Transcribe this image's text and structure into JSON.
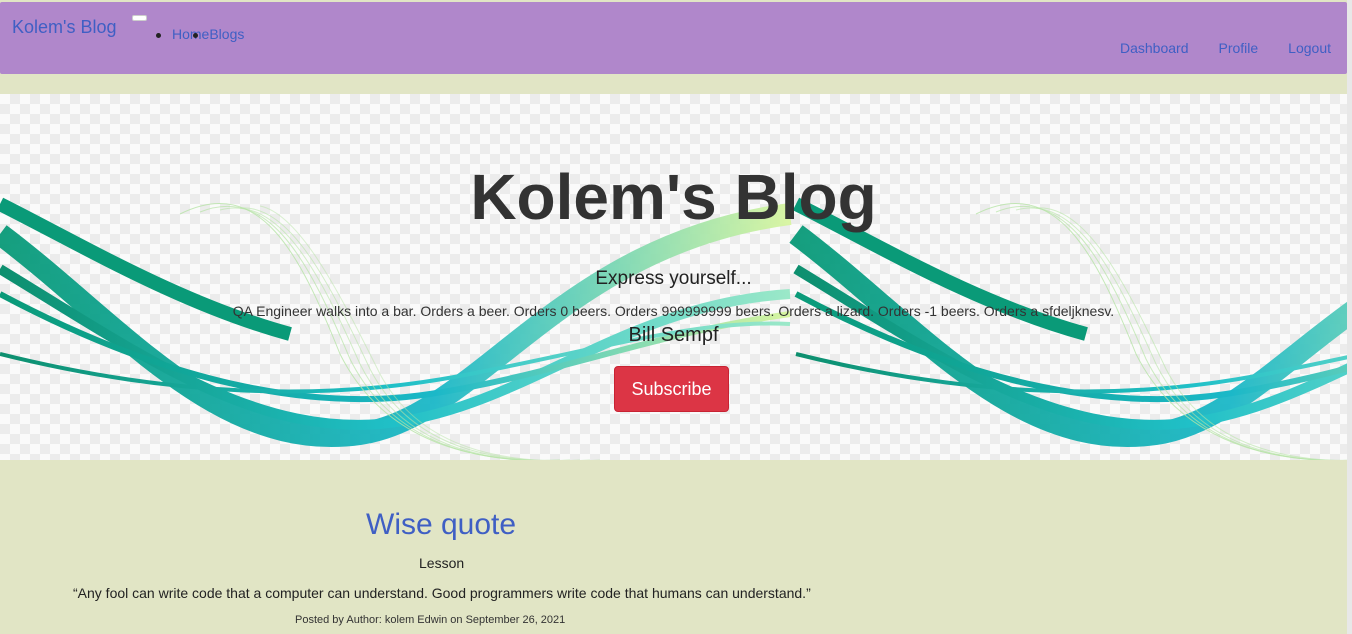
{
  "nav": {
    "brand": "Kolem's Blog",
    "left_links": "HomeBlogs",
    "right_links": [
      "Dashboard",
      "Profile",
      "Logout"
    ]
  },
  "hero": {
    "title": "Kolem's Blog",
    "subtitle": "Express yourself...",
    "quote": "QA Engineer walks into a bar. Orders a beer. Orders 0 beers. Orders 999999999 beers. Orders a lizard. Orders -1 beers. Orders a sfdeljknesv.",
    "author": "Bill Sempf",
    "subscribe_label": "Subscribe"
  },
  "post": {
    "title": "Wise quote",
    "tag": "Lesson",
    "body": "“Any fool can write code that a computer can understand. Good programmers write code that humans can understand.”",
    "meta": "Posted by Author: kolem Edwin on September 26, 2021"
  },
  "colors": {
    "navbar": "#b087cb",
    "page_background": "#e1e5c5",
    "link": "#3f5fc4",
    "subscribe": "#dc3545"
  }
}
